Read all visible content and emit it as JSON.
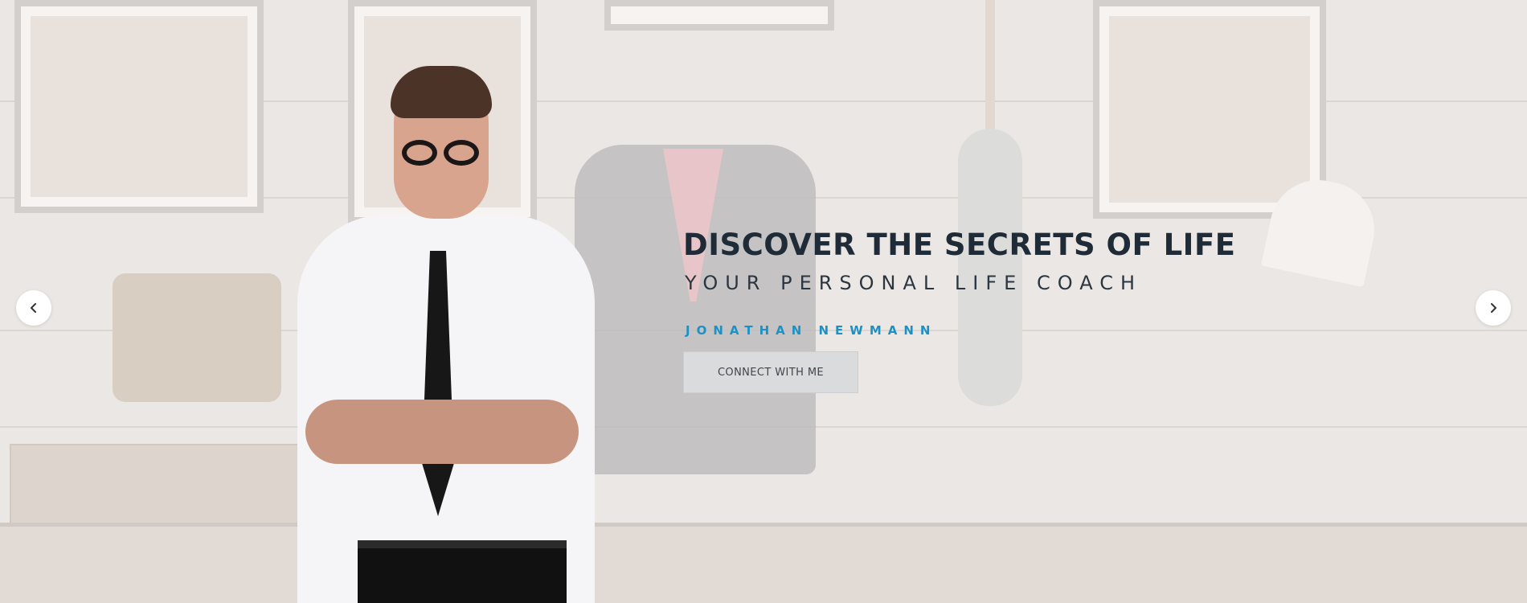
{
  "hero": {
    "title": "DISCOVER THE SECRETS OF LIFE",
    "subtitle": "YOUR PERSONAL LIFE COACH",
    "name": "JONATHAN NEWMANN",
    "button_label": "CONNECT WITH ME"
  },
  "carousel": {
    "prev_icon": "chevron-left-icon",
    "next_icon": "chevron-right-icon"
  },
  "colors": {
    "title": "#1f2b36",
    "subtitle": "#2c3640",
    "name_accent": "#1b92c6",
    "button_bg": "#dadbdd",
    "background": "#ebe7e4"
  }
}
